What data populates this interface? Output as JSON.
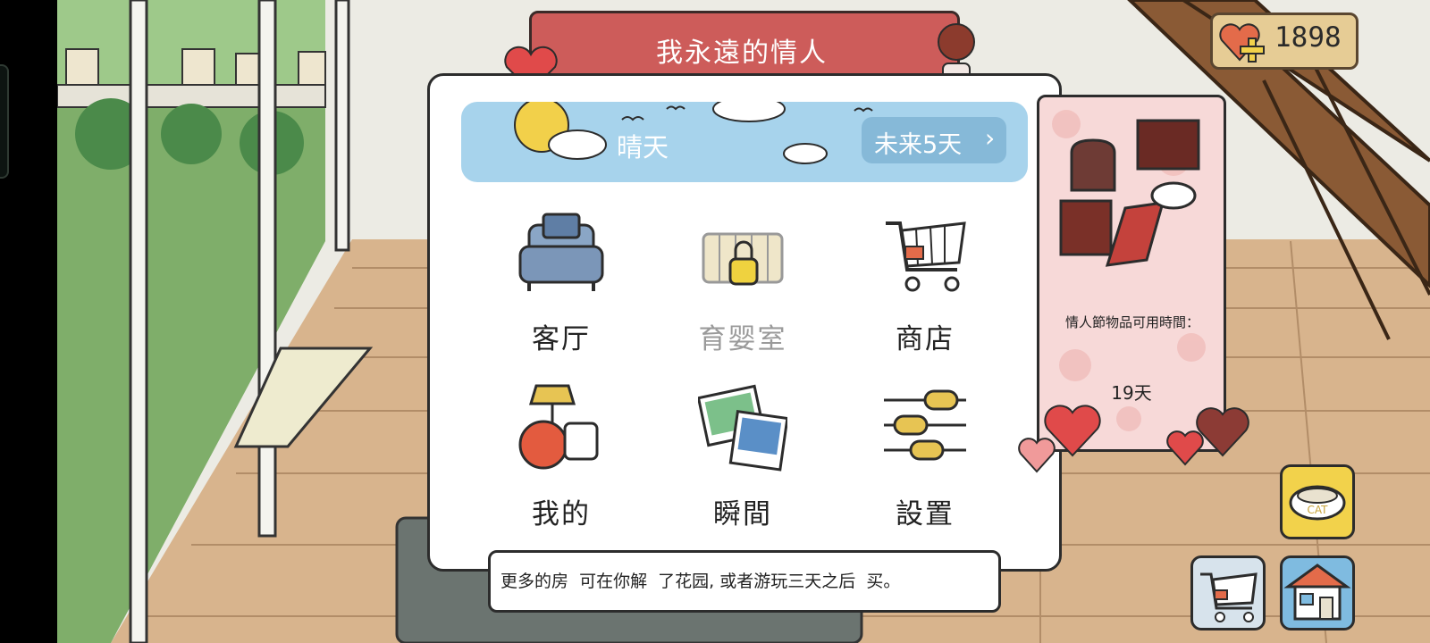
{
  "header": {
    "title": "我永遠的情人"
  },
  "currency": {
    "icon": "heart-plus-icon",
    "value": "1898"
  },
  "weather": {
    "label": "晴天",
    "forecast_button": "未来5天",
    "forecast_arrow": "›"
  },
  "menu": {
    "items": [
      {
        "label": "客厅",
        "icon": "armchair-icon",
        "locked": false
      },
      {
        "label": "育婴室",
        "icon": "crib-icon",
        "locked": true
      },
      {
        "label": "商店",
        "icon": "shopping-cart-icon",
        "locked": false
      },
      {
        "label": "我的",
        "icon": "lamp-tomato-mug-icon",
        "locked": false
      },
      {
        "label": "瞬間",
        "icon": "photos-icon",
        "locked": false
      },
      {
        "label": "設置",
        "icon": "sliders-icon",
        "locked": false
      }
    ]
  },
  "hint": {
    "text": "更多的房  可在你解  了花园, 或者游玩三天之后  买。"
  },
  "event": {
    "label": "情人節物品可用時間：",
    "days": "19天"
  },
  "buttons": {
    "cat_bowl": {
      "icon": "cat-bowl-icon",
      "label": "CAT"
    },
    "cart": {
      "icon": "shopping-cart-icon"
    },
    "home": {
      "icon": "house-icon"
    }
  },
  "colors": {
    "banner": "#cd5c5a",
    "sky": "#a7d3ec",
    "event_panel": "#f7d9d8",
    "cat_button": "#f2d24b",
    "home_button": "#7fbbe0"
  }
}
